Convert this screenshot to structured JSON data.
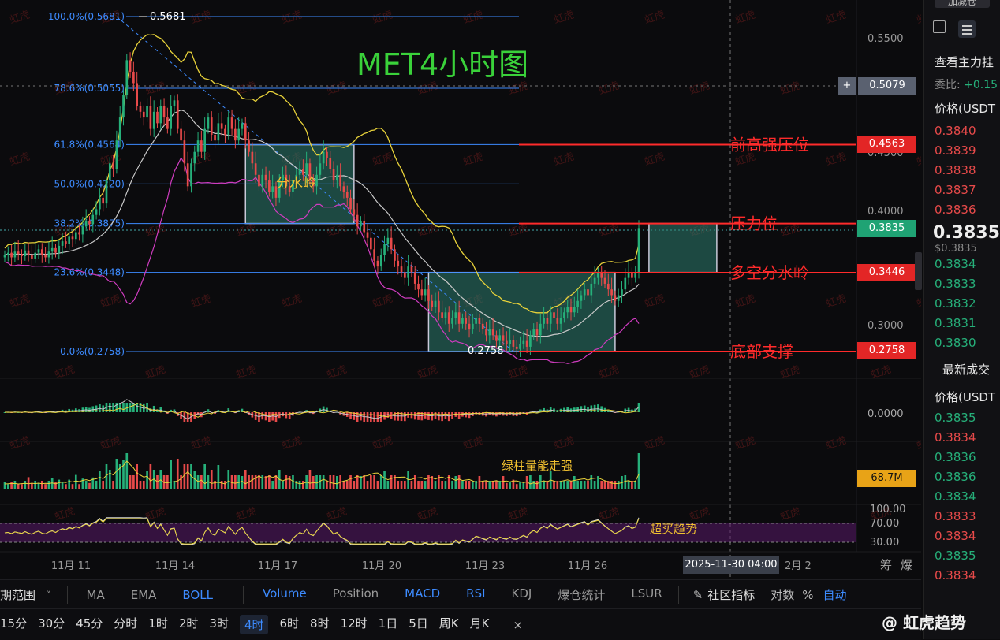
{
  "chart_data": {
    "type": "candlestick",
    "title": "MET4小时图",
    "ylim": [
      0.26,
      0.58
    ],
    "y_ticks": [
      "0.5500",
      "0.4500",
      "0.4000",
      "0.3000"
    ],
    "x_tick_labels": [
      "11月 11",
      "11月 14",
      "11月 17",
      "11月 20",
      "11月 23",
      "11月 26",
      "2月 2"
    ],
    "crosshair_time": "2025-11-30 04:00",
    "crosshair_price": "0.5079",
    "last_price": "0.3835",
    "high_label": "0.5681",
    "low_label": "0.2758",
    "fib_levels": [
      {
        "label": "100.0%(0.5681)",
        "price": 0.5681
      },
      {
        "label": "78.6%(0.5055)",
        "price": 0.5055
      },
      {
        "label": "61.8%(0.4564)",
        "price": 0.4564
      },
      {
        "label": "50.0%(0.4220)",
        "price": 0.422
      },
      {
        "label": "38.2%(0.3875)",
        "price": 0.3875
      },
      {
        "label": "23.6%(0.3448)",
        "price": 0.3448
      },
      {
        "label": "0.0%(0.2758)",
        "price": 0.2758
      }
    ],
    "key_levels": [
      {
        "name": "前高强压位",
        "price": 0.4563,
        "price_label": "0.4563"
      },
      {
        "name": "压力位",
        "price": 0.3875,
        "price_label": "0.3835"
      },
      {
        "name": "多空分水岭",
        "price": 0.3446,
        "price_label": "0.3446"
      },
      {
        "name": "底部支撑",
        "price": 0.2758,
        "price_label": "0.2758"
      }
    ],
    "zone_label": "分水岭",
    "zones": [
      {
        "start_index": 71,
        "end_index": 103,
        "top": 0.4563,
        "bottom": 0.3875
      },
      {
        "start_index": 125,
        "end_index": 180,
        "top": 0.3448,
        "bottom": 0.2758
      },
      {
        "start_index": 190,
        "end_index": 210,
        "top": 0.3875,
        "bottom": 0.3448
      }
    ],
    "closes": [
      0.36,
      0.362,
      0.358,
      0.363,
      0.361,
      0.359,
      0.364,
      0.36,
      0.357,
      0.362,
      0.365,
      0.36,
      0.358,
      0.363,
      0.366,
      0.362,
      0.368,
      0.372,
      0.37,
      0.376,
      0.374,
      0.38,
      0.378,
      0.385,
      0.39,
      0.387,
      0.395,
      0.4,
      0.41,
      0.405,
      0.425,
      0.44,
      0.435,
      0.46,
      0.48,
      0.5,
      0.53,
      0.52,
      0.51,
      0.49,
      0.485,
      0.48,
      0.49,
      0.47,
      0.485,
      0.475,
      0.49,
      0.48,
      0.47,
      0.49,
      0.495,
      0.47,
      0.46,
      0.44,
      0.42,
      0.44,
      0.45,
      0.46,
      0.45,
      0.47,
      0.48,
      0.465,
      0.46,
      0.475,
      0.47,
      0.465,
      0.48,
      0.47,
      0.46,
      0.47,
      0.475,
      0.46,
      0.45,
      0.44,
      0.43,
      0.42,
      0.43,
      0.425,
      0.415,
      0.42,
      0.41,
      0.425,
      0.43,
      0.42,
      0.415,
      0.425,
      0.43,
      0.435,
      0.43,
      0.44,
      0.425,
      0.42,
      0.43,
      0.44,
      0.45,
      0.445,
      0.435,
      0.425,
      0.43,
      0.42,
      0.415,
      0.41,
      0.4,
      0.395,
      0.385,
      0.39,
      0.38,
      0.375,
      0.365,
      0.355,
      0.35,
      0.36,
      0.37,
      0.375,
      0.365,
      0.355,
      0.35,
      0.345,
      0.34,
      0.35,
      0.345,
      0.335,
      0.33,
      0.325,
      0.33,
      0.32,
      0.315,
      0.32,
      0.31,
      0.305,
      0.31,
      0.3,
      0.305,
      0.31,
      0.3,
      0.305,
      0.3,
      0.295,
      0.3,
      0.305,
      0.3,
      0.295,
      0.29,
      0.295,
      0.29,
      0.285,
      0.29,
      0.285,
      0.282,
      0.286,
      0.28,
      0.278,
      0.282,
      0.285,
      0.28,
      0.29,
      0.295,
      0.29,
      0.3,
      0.305,
      0.3,
      0.31,
      0.305,
      0.3,
      0.305,
      0.31,
      0.315,
      0.31,
      0.315,
      0.32,
      0.325,
      0.33,
      0.325,
      0.335,
      0.34,
      0.345,
      0.34,
      0.335,
      0.33,
      0.325,
      0.32,
      0.325,
      0.33,
      0.34,
      0.345,
      0.34,
      0.345,
      0.3835
    ]
  },
  "indicator_labels": {
    "macd_zero": "0.0000",
    "volume_note": "绿柱量能走强",
    "volume_value": "68.7M",
    "rsi_ticks": [
      "100.00",
      "70.00",
      "30.00"
    ],
    "rsi_note": "超买趋势"
  },
  "right_axis_icons": [
    "+"
  ],
  "sidebar": {
    "top_button": "加减仓",
    "main_force": "查看主力挂",
    "ratio_label": "委比:",
    "ratio_value": "+0.15",
    "price_header": "价格(USDT",
    "asks": [
      "0.3840",
      "0.3839",
      "0.3838",
      "0.3837",
      "0.3836"
    ],
    "last_price": "0.3835",
    "last_price_sub": "$0.3835",
    "bids": [
      "0.3834",
      "0.3833",
      "0.3832",
      "0.3831",
      "0.3830"
    ],
    "trades_title": "最新成交",
    "trades_header": "价格(USDT",
    "trades": [
      {
        "p": "0.3835",
        "c": "green"
      },
      {
        "p": "0.3834",
        "c": "red"
      },
      {
        "p": "0.3836",
        "c": "green"
      },
      {
        "p": "0.3836",
        "c": "green"
      },
      {
        "p": "0.3834",
        "c": "green"
      },
      {
        "p": "0.3833",
        "c": "red"
      },
      {
        "p": "0.3834",
        "c": "red"
      },
      {
        "p": "0.3835",
        "c": "green"
      },
      {
        "p": "0.3834",
        "c": "red"
      }
    ]
  },
  "toolbar1": {
    "range_label": "期范围",
    "indicators": [
      "MA",
      "EMA",
      "BOLL"
    ],
    "active_indicator": "BOLL",
    "subcharts": [
      "Volume",
      "Position",
      "MACD",
      "RSI",
      "KDJ",
      "爆仓统计",
      "LSUR"
    ],
    "active_subcharts": [
      "Volume",
      "MACD",
      "RSI"
    ],
    "community": "社区指标",
    "log": "对数",
    "percent": "%",
    "auto": "自动",
    "axis_right": [
      "筹",
      "爆"
    ]
  },
  "toolbar2": {
    "intervals": [
      "15分",
      "30分",
      "45分",
      "分时",
      "1时",
      "2时",
      "3时",
      "4时",
      "6时",
      "8时",
      "12时",
      "1日",
      "5日",
      "周K",
      "月K"
    ],
    "active_interval": "4时",
    "close": "×"
  },
  "watermark": {
    "brand": "@ 虹虎趋势",
    "tile": "虹虎"
  },
  "colors": {
    "up": "#26b07a",
    "down": "#e84a4a",
    "fib": "#3d8bff",
    "title": "#3ad13a",
    "level": "#ff2b2b",
    "annotation": "#f0c030"
  }
}
